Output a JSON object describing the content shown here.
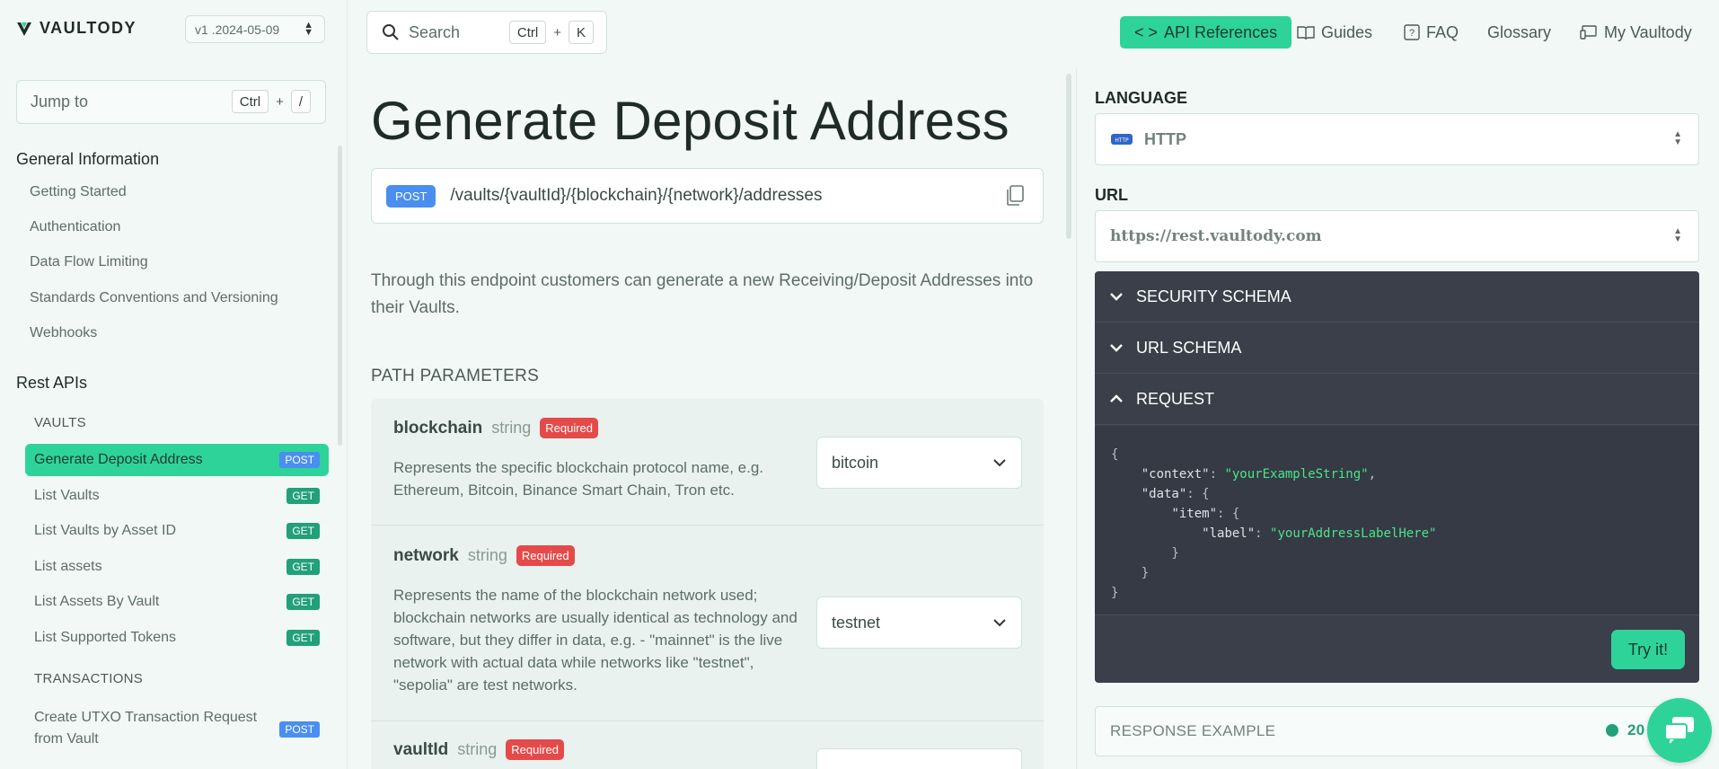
{
  "brand": {
    "name": "VAULTODY"
  },
  "version": {
    "selected": "v1 .2024-05-09"
  },
  "jump": {
    "placeholder": "Jump to",
    "key1": "Ctrl",
    "plus": "+",
    "key2": "/"
  },
  "search": {
    "placeholder": "Search",
    "key1": "Ctrl",
    "plus": "+",
    "key2": "K"
  },
  "topnav": {
    "api_references": "API References",
    "guides": "Guides",
    "faq": "FAQ",
    "glossary": "Glossary",
    "my_vaultody": "My Vaultody"
  },
  "sidebar": {
    "general_heading": "General Information",
    "general_items": [
      "Getting Started",
      "Authentication",
      "Data Flow Limiting",
      "Standards Conventions and Versioning",
      "Webhooks"
    ],
    "rest_heading": "Rest APIs",
    "vaults_heading": "VAULTS",
    "vault_items": [
      {
        "label": "Generate Deposit Address",
        "method": "POST"
      },
      {
        "label": "List Vaults",
        "method": "GET"
      },
      {
        "label": "List Vaults by Asset ID",
        "method": "GET"
      },
      {
        "label": "List assets",
        "method": "GET"
      },
      {
        "label": "List Assets By Vault",
        "method": "GET"
      },
      {
        "label": "List Supported Tokens",
        "method": "GET"
      }
    ],
    "transactions_heading": "TRANSACTIONS",
    "transaction_items": [
      {
        "label_line1": "Create UTXO Transaction Request",
        "label_line2": "from Vault",
        "method": "POST"
      }
    ]
  },
  "main": {
    "title": "Generate Deposit Address",
    "method": "POST",
    "path": "/vaults/{vaultId}/{blockchain}/{network}/addresses",
    "description": "Through this endpoint customers can generate a new Receiving/Deposit Addresses into their Vaults.",
    "path_params_title": "PATH PARAMETERS",
    "params": [
      {
        "name": "blockchain",
        "type": "string",
        "required": "Required",
        "description": "Represents the specific blockchain protocol name, e.g. Ethereum, Bitcoin, Binance Smart Chain, Tron etc.",
        "value": "bitcoin"
      },
      {
        "name": "network",
        "type": "string",
        "required": "Required",
        "description": "Represents the name of the blockchain network used; blockchain networks are usually identical as technology and software, but they differ in data, e.g. - \"mainnet\" is the live network with actual data while networks like \"testnet\", \"sepolia\" are test networks.",
        "value": "testnet"
      },
      {
        "name": "vaultId",
        "type": "string",
        "required": "Required"
      }
    ]
  },
  "right": {
    "language_label": "LANGUAGE",
    "language_value": "HTTP",
    "language_icon_text": "HTTP",
    "url_label": "URL",
    "url_value": "https://rest.vaultody.com",
    "security_schema": "SECURITY SCHEMA",
    "url_schema": "URL SCHEMA",
    "request": "REQUEST",
    "code": {
      "context_key": "\"context\"",
      "context_val": "\"yourExampleString\"",
      "data_key": "\"data\"",
      "item_key": "\"item\"",
      "label_key": "\"label\"",
      "label_val": "\"yourAddressLabelHere\""
    },
    "try_it": "Try it!",
    "response_example": "RESPONSE EXAMPLE",
    "response_status": "20"
  },
  "colors": {
    "accent": "#2ed39a",
    "get_badge": "#22a07a",
    "post_badge": "#4a8ef0",
    "required": "#e54a4a",
    "dark_panel": "#3a3f4a",
    "code_string": "#4ce38a"
  },
  "icons": [
    "vaultody-logo-icon",
    "updown-icon",
    "search-icon",
    "code-icon",
    "book-icon",
    "help-icon",
    "devices-icon",
    "copy-icon",
    "chevron-down-icon",
    "chevron-up-icon",
    "http-icon",
    "chat-icon"
  ]
}
